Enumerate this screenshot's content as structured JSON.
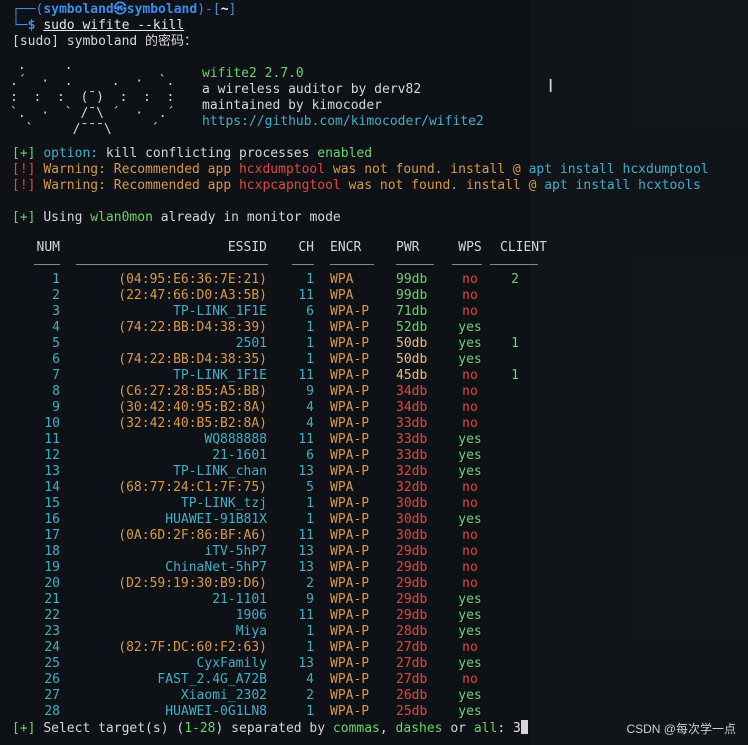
{
  "prompt": {
    "corner_top": "┌──(",
    "user_host": "symboland㉿symboland",
    "dash_bracket": ")-[",
    "cwd": "~",
    "close_bracket": "]",
    "corner_bottom": "└─",
    "dollar": "$ ",
    "command": "sudo wifite --kill"
  },
  "sudo_prompt": "[sudo] symboland 的密码：",
  "logo_ascii": " .     .\n.´  ·  .     .  ·  `.\n:  :  :  (¯)  :  :  :\n`.  ·  ` /¯\\ ´  ·  .´\n  `     /¯¯¯\\     ´",
  "banner": {
    "name": "wifite2 2.7.0",
    "line2": "a wireless auditor by derv82",
    "line3": "maintained by kimocoder",
    "url": "https://github.com/kimocoder/wifite2"
  },
  "messages": {
    "opt_prefix": "[+] ",
    "opt_label": "option:",
    "opt_text": " kill conflicting processes ",
    "opt_value": "enabled",
    "warn1_prefix": "[!] ",
    "warn1_label": "Warning: Recommended app ",
    "warn1_app": "hcxdumptool",
    "warn1_mid": " was not found. install @ ",
    "warn1_apt": "apt install hcxdumptool",
    "warn2_prefix": "[!] ",
    "warn2_label": "Warning: Recommended app ",
    "warn2_app": "hcxpcapngtool",
    "warn2_mid": " was not found. install @ ",
    "warn2_apt": "apt install hcxtools",
    "using_prefix": "[+] ",
    "using_a": "Using ",
    "using_iface": "wlan0mon",
    "using_b": " already in monitor mode"
  },
  "table": {
    "headers": [
      "NUM",
      "ESSID",
      "CH",
      "ENCR",
      "PWR",
      "WPS",
      "CLIENT"
    ],
    "rows": [
      {
        "num": "1",
        "essid": "(04:95:E6:36:7E:21)",
        "ch": "1",
        "encr": "WPA",
        "pwr": "99db",
        "wps": "no",
        "client": "2",
        "hidden": true,
        "pc": "green"
      },
      {
        "num": "2",
        "essid": "(22:47:66:D0:A3:5B)",
        "ch": "11",
        "encr": "WPA",
        "pwr": "99db",
        "wps": "no",
        "client": "",
        "hidden": true,
        "pc": "green"
      },
      {
        "num": "3",
        "essid": "TP-LINK_1F1E",
        "ch": "6",
        "encr": "WPA-P",
        "pwr": "71db",
        "wps": "no",
        "client": "",
        "hidden": false,
        "pc": "green"
      },
      {
        "num": "4",
        "essid": "(74:22:BB:D4:38:39)",
        "ch": "1",
        "encr": "WPA-P",
        "pwr": "52db",
        "wps": "yes",
        "client": "",
        "hidden": true,
        "pc": "green"
      },
      {
        "num": "5",
        "essid": "2501",
        "ch": "1",
        "encr": "WPA-P",
        "pwr": "50db",
        "wps": "yes",
        "client": "1",
        "hidden": false,
        "pc": "yellow"
      },
      {
        "num": "6",
        "essid": "(74:22:BB:D4:38:35)",
        "ch": "1",
        "encr": "WPA-P",
        "pwr": "50db",
        "wps": "yes",
        "client": "",
        "hidden": true,
        "pc": "yellow"
      },
      {
        "num": "7",
        "essid": "TP-LINK_1F1E",
        "ch": "11",
        "encr": "WPA-P",
        "pwr": "45db",
        "wps": "no",
        "client": "1",
        "hidden": false,
        "pc": "yellow"
      },
      {
        "num": "8",
        "essid": "(C6:27:28:B5:A5:BB)",
        "ch": "9",
        "encr": "WPA-P",
        "pwr": "34db",
        "wps": "no",
        "client": "",
        "hidden": true,
        "pc": "red"
      },
      {
        "num": "9",
        "essid": "(30:42:40:95:B2:8A)",
        "ch": "4",
        "encr": "WPA-P",
        "pwr": "34db",
        "wps": "no",
        "client": "",
        "hidden": true,
        "pc": "red"
      },
      {
        "num": "10",
        "essid": "(32:42:40:B5:B2:8A)",
        "ch": "4",
        "encr": "WPA-P",
        "pwr": "33db",
        "wps": "no",
        "client": "",
        "hidden": true,
        "pc": "red"
      },
      {
        "num": "11",
        "essid": "WQ888888",
        "ch": "11",
        "encr": "WPA-P",
        "pwr": "33db",
        "wps": "yes",
        "client": "",
        "hidden": false,
        "pc": "red"
      },
      {
        "num": "12",
        "essid": "21-1601",
        "ch": "6",
        "encr": "WPA-P",
        "pwr": "33db",
        "wps": "yes",
        "client": "",
        "hidden": false,
        "pc": "red"
      },
      {
        "num": "13",
        "essid": "TP-LINK_chan",
        "ch": "13",
        "encr": "WPA-P",
        "pwr": "32db",
        "wps": "yes",
        "client": "",
        "hidden": false,
        "pc": "red"
      },
      {
        "num": "14",
        "essid": "(68:77:24:C1:7F:75)",
        "ch": "5",
        "encr": "WPA",
        "pwr": "32db",
        "wps": "no",
        "client": "",
        "hidden": true,
        "pc": "red"
      },
      {
        "num": "15",
        "essid": "TP-LINK_tzj",
        "ch": "1",
        "encr": "WPA-P",
        "pwr": "30db",
        "wps": "no",
        "client": "",
        "hidden": false,
        "pc": "red"
      },
      {
        "num": "16",
        "essid": "HUAWEI-91B81X",
        "ch": "1",
        "encr": "WPA-P",
        "pwr": "30db",
        "wps": "yes",
        "client": "",
        "hidden": false,
        "pc": "red"
      },
      {
        "num": "17",
        "essid": "(0A:6D:2F:86:BF:A6)",
        "ch": "11",
        "encr": "WPA-P",
        "pwr": "30db",
        "wps": "no",
        "client": "",
        "hidden": true,
        "pc": "red"
      },
      {
        "num": "18",
        "essid": "iTV-5hP7",
        "ch": "13",
        "encr": "WPA-P",
        "pwr": "29db",
        "wps": "no",
        "client": "",
        "hidden": false,
        "pc": "red"
      },
      {
        "num": "19",
        "essid": "ChinaNet-5hP7",
        "ch": "13",
        "encr": "WPA-P",
        "pwr": "29db",
        "wps": "no",
        "client": "",
        "hidden": false,
        "pc": "red"
      },
      {
        "num": "20",
        "essid": "(D2:59:19:30:B9:D6)",
        "ch": "2",
        "encr": "WPA-P",
        "pwr": "29db",
        "wps": "no",
        "client": "",
        "hidden": true,
        "pc": "red"
      },
      {
        "num": "21",
        "essid": "21-1101",
        "ch": "9",
        "encr": "WPA-P",
        "pwr": "29db",
        "wps": "yes",
        "client": "",
        "hidden": false,
        "pc": "red"
      },
      {
        "num": "22",
        "essid": "1906",
        "ch": "11",
        "encr": "WPA-P",
        "pwr": "29db",
        "wps": "yes",
        "client": "",
        "hidden": false,
        "pc": "red"
      },
      {
        "num": "23",
        "essid": "Miya",
        "ch": "1",
        "encr": "WPA-P",
        "pwr": "28db",
        "wps": "yes",
        "client": "",
        "hidden": false,
        "pc": "red"
      },
      {
        "num": "24",
        "essid": "(82:7F:DC:60:F2:63)",
        "ch": "1",
        "encr": "WPA-P",
        "pwr": "27db",
        "wps": "no",
        "client": "",
        "hidden": true,
        "pc": "red"
      },
      {
        "num": "25",
        "essid": "CyxFamily",
        "ch": "13",
        "encr": "WPA-P",
        "pwr": "27db",
        "wps": "yes",
        "client": "",
        "hidden": false,
        "pc": "red"
      },
      {
        "num": "26",
        "essid": "FAST_2.4G_A72B",
        "ch": "4",
        "encr": "WPA-P",
        "pwr": "27db",
        "wps": "no",
        "client": "",
        "hidden": false,
        "pc": "red"
      },
      {
        "num": "27",
        "essid": "Xiaomi_2302",
        "ch": "2",
        "encr": "WPA-P",
        "pwr": "26db",
        "wps": "yes",
        "client": "",
        "hidden": false,
        "pc": "red"
      },
      {
        "num": "28",
        "essid": "HUAWEI-0G1LN8",
        "ch": "1",
        "encr": "WPA-P",
        "pwr": "25db",
        "wps": "yes",
        "client": "",
        "hidden": false,
        "pc": "red"
      }
    ]
  },
  "select": {
    "prefix": "[+] ",
    "a": "Select target(s) (",
    "range": "1-28",
    "b": ") separated by ",
    "commas": "commas",
    "c": ", ",
    "dashes": "dashes",
    "d": " or ",
    "all": "all",
    "e": ": ",
    "input": "3"
  },
  "watermark": "CSDN @每次学一点",
  "colors": {
    "background": "#0e1115",
    "prompt_blue": "#3b8eea",
    "green": "#6ad46a",
    "red": "#e0483f",
    "orange": "#d89a45",
    "cyan": "#3fb0c9",
    "yellow": "#e5c07b"
  }
}
